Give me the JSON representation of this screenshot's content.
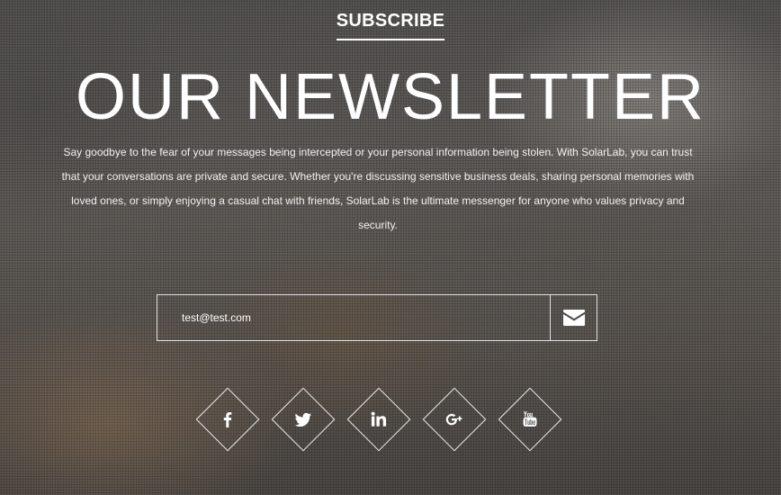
{
  "section": {
    "subscribe_label": "SUBSCRIBE",
    "headline": "OUR NEWSLETTER",
    "description": "Say goodbye to the fear of your messages being intercepted or your personal information being stolen. With SolarLab, you can trust that your conversations are private and secure. Whether you're discussing sensitive business deals, sharing personal memories with loved ones, or simply enjoying a casual chat with friends, SolarLab is the ultimate messenger for anyone who values privacy and security."
  },
  "form": {
    "email_value": "test@test.com",
    "submit_icon": "envelope-icon"
  },
  "socials": [
    {
      "name": "facebook",
      "icon": "facebook-icon"
    },
    {
      "name": "twitter",
      "icon": "twitter-icon"
    },
    {
      "name": "linkedin",
      "icon": "linkedin-icon"
    },
    {
      "name": "google-plus",
      "icon": "google-plus-icon"
    },
    {
      "name": "youtube",
      "icon": "youtube-icon"
    }
  ],
  "colors": {
    "text": "#ffffff",
    "border": "#ffffff"
  }
}
